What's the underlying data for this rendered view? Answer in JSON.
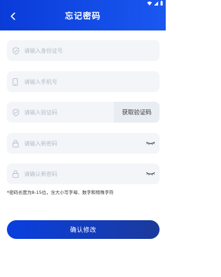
{
  "header": {
    "title": "忘记密码",
    "back_icon": "chevron-left-icon"
  },
  "status_bar": {
    "icons": [
      "wifi-icon",
      "signal-icon",
      "battery-icon"
    ]
  },
  "form": {
    "id_card": {
      "placeholder": "请输入身份证号",
      "value": "",
      "icon": "shield-check-icon"
    },
    "phone": {
      "placeholder": "请输入手机号",
      "value": "",
      "icon": "phone-icon"
    },
    "code": {
      "placeholder": "请输入验证码",
      "value": "",
      "icon": "shield-check-icon",
      "button_label": "获取验证码"
    },
    "new_password": {
      "placeholder": "请输入新密码",
      "value": "",
      "icon": "lock-icon",
      "toggle_icon": "eye-closed-icon"
    },
    "confirm_password": {
      "placeholder": "请确认新密码",
      "value": "",
      "icon": "lock-icon",
      "toggle_icon": "eye-closed-icon"
    }
  },
  "hint": "*密码长度为8-15位，含大小写字母、数字和特殊字符",
  "submit_label": "确认修改",
  "colors": {
    "primary": "#0a3bd8",
    "button_end": "#1b3a9c",
    "field_bg": "#f3f5f9"
  }
}
